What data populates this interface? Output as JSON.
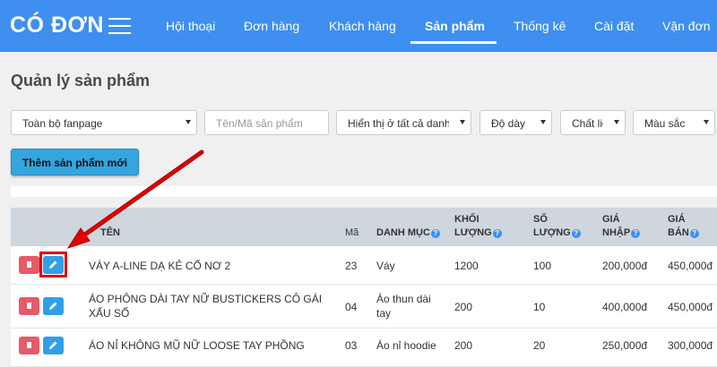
{
  "header": {
    "logo": "CÓ ĐƠN",
    "nav": [
      "Hội thoại",
      "Đơn hàng",
      "Khách hàng",
      "Sản phẩm",
      "Thống kê",
      "Cài đặt",
      "Vận đơn"
    ],
    "active_nav": "Sản phẩm",
    "color": "#3e8ff0"
  },
  "page": {
    "title": "Quản lý sản phẩm"
  },
  "filters": {
    "fanpage": "Toàn bộ fanpage",
    "search_placeholder": "Tên/Mã sản phẩm",
    "category": "Hiển thị ở tất cả danh m",
    "thickness": "Độ dày",
    "material": "Chất liệ",
    "color": "Màu sắc"
  },
  "add_button": "Thêm sản phẩm mới",
  "table": {
    "headers": {
      "name": "TÊN",
      "code": "Mã",
      "category": "DANH MỤC",
      "weight_1": "KHỐI",
      "weight_2": "LƯỢNG",
      "qty_1": "SỐ",
      "qty_2": "LƯỢNG",
      "cost_1": "GIÁ",
      "cost_2": "NHẬP",
      "price_1": "GIÁ",
      "price_2": "BÁN"
    },
    "rows": [
      {
        "name": "VÁY A-LINE DẠ KẺ CỔ NƠ 2",
        "code": "23",
        "category": "Váy",
        "weight": "1200",
        "qty": "100",
        "cost": "200,000đ",
        "price": "450,000đ"
      },
      {
        "name_line1": "ÁO PHÔNG DÀI TAY NỮ BUSTICKERS CÔ GÁI",
        "name_line2": "XẤU SỐ",
        "code": "04",
        "category_line1": "Áo thun dài",
        "category_line2": "tay",
        "weight": "200",
        "qty": "10",
        "cost": "400,000đ",
        "price": "450,000đ"
      },
      {
        "name": "ÁO NỈ KHÔNG MŨ NỮ LOOSE TAY PHỒNG",
        "code": "03",
        "category": "Áo nỉ hoodie",
        "weight": "200",
        "qty": "20",
        "cost": "250,000đ",
        "price": "300,000đ"
      }
    ]
  },
  "colors": {
    "delete": "#e65a69",
    "edit": "#2fa0e8",
    "annotation": "#e60000"
  }
}
